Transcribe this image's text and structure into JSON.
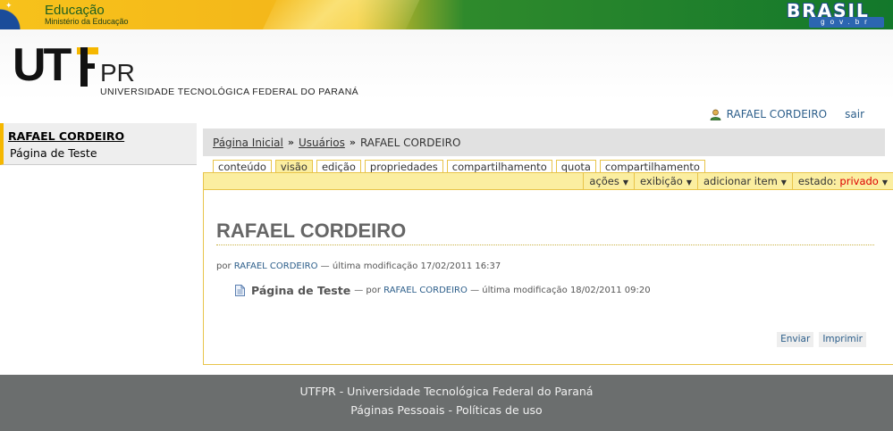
{
  "gov": {
    "educacao": "Educação",
    "ministerio": "Ministério da Educação",
    "brasil": "BRASIL",
    "govbr": "gov.br"
  },
  "logo": {
    "ut": "UT",
    "pr": "PR",
    "subtitle": "UNIVERSIDADE TECNOLÓGICA FEDERAL DO PARANÁ"
  },
  "user": {
    "name": "RAFAEL CORDEIRO",
    "logout": "sair"
  },
  "leftnav": {
    "items": [
      {
        "label": "RAFAEL CORDEIRO"
      },
      {
        "label": "Página de Teste"
      }
    ]
  },
  "breadcrumb": {
    "items": [
      "Página Inicial",
      "Usuários",
      "RAFAEL CORDEIRO"
    ],
    "separator": "»"
  },
  "tabs": [
    {
      "label": "conteúdo"
    },
    {
      "label": "visão"
    },
    {
      "label": "edição"
    },
    {
      "label": "propriedades"
    },
    {
      "label": "compartilhamento"
    },
    {
      "label": "quota"
    },
    {
      "label": "compartilhamento"
    }
  ],
  "actions": {
    "acoes": "ações",
    "exibicao": "exibição",
    "adicionar": "adicionar item",
    "estado_label": "estado:",
    "estado_value": "privado",
    "arrow": "▼"
  },
  "content": {
    "title": "RAFAEL CORDEIRO",
    "byline": {
      "prefix": "por",
      "author": "RAFAEL CORDEIRO",
      "modified": "— última modificação 17/02/2011 16:37"
    },
    "items": [
      {
        "name": "Página de Teste",
        "prefix": "— por",
        "author": "RAFAEL CORDEIRO",
        "modified": "— última modificação 18/02/2011 09:20"
      }
    ],
    "buttons": {
      "send": "Enviar",
      "print": "Imprimir"
    }
  },
  "footer": {
    "line1": "UTFPR - Universidade Tecnológica Federal do Paraná",
    "line2": "Páginas Pessoais - Políticas de uso"
  },
  "colors": {
    "accent_yellow": "#f5b700",
    "tab_bar": "#fbeea0",
    "link_blue": "#2c5e8a",
    "footer_gray": "#6b6e6e"
  }
}
